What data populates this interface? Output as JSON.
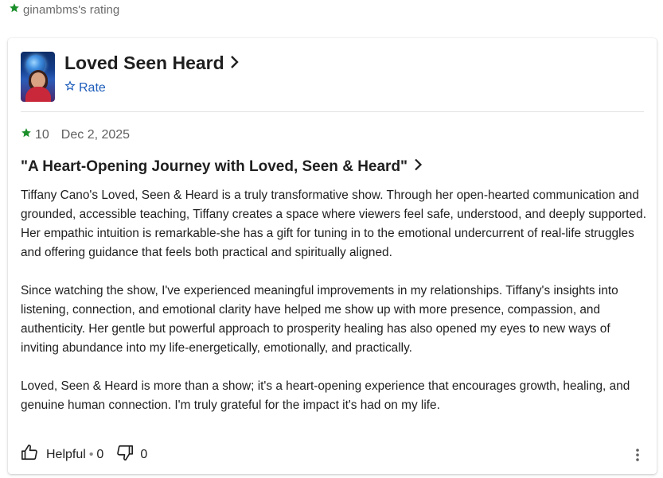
{
  "header": {
    "rating_owner_text": "ginambms's rating",
    "star_icon": "star-filled-icon",
    "star_color": "#1a8f2a"
  },
  "show": {
    "title": "Loved Seen Heard",
    "poster_icon": "show-poster",
    "rate_label": "Rate",
    "rate_icon": "star-outline-icon",
    "link_color": "#1d5dba"
  },
  "review": {
    "score": "10",
    "date": "Dec 2, 2025",
    "title": "\"A Heart-Opening Journey with Loved, Seen & Heard\"",
    "paragraphs": [
      "Tiffany Cano's Loved, Seen & Heard is a truly transformative show. Through her open-hearted communication and grounded, accessible teaching, Tiffany creates a space where viewers feel safe, understood, and deeply supported. Her empathic intuition is remarkable-she has a gift for tuning in to the emotional undercurrent of real-life struggles and offering guidance that feels both practical and spiritually aligned.",
      "Since watching the show, I've experienced meaningful improvements in my relationships. Tiffany's insights into listening, connection, and emotional clarity have helped me show up with more presence, compassion, and authenticity. Her gentle but powerful approach to prosperity healing has also opened my eyes to new ways of inviting abundance into my life-energetically, emotionally, and practically.",
      "Loved, Seen & Heard is more than a show; it's a heart-opening experience that encourages growth, healing, and genuine human connection. I'm truly grateful for the impact it's had on my life."
    ]
  },
  "actions": {
    "helpful_label": "Helpful",
    "separator": "•",
    "helpful_count": "0",
    "unhelpful_count": "0",
    "more_icon": "more-vertical-icon"
  }
}
